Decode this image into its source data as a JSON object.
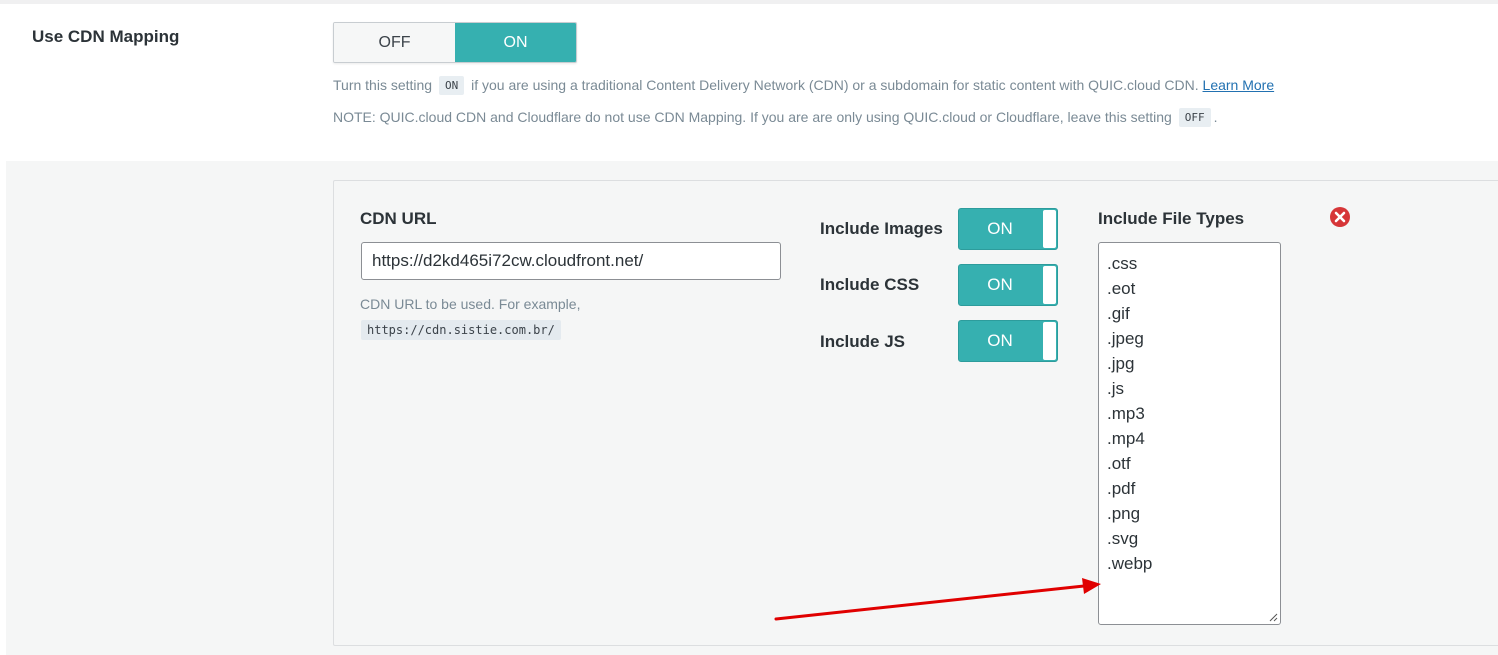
{
  "setting": {
    "label": "Use CDN Mapping",
    "toggle": {
      "off_label": "OFF",
      "on_label": "ON",
      "selected": "ON"
    },
    "description": {
      "line1_before": "Turn this setting",
      "line1_code": "ON",
      "line1_after": "if you are using a traditional Content Delivery Network (CDN) or a subdomain for static content with QUIC.cloud CDN.",
      "learn_more": "Learn More",
      "line2_before": "NOTE: QUIC.cloud CDN and Cloudflare do not use CDN Mapping. If you are are only using QUIC.cloud or Cloudflare, leave this setting",
      "line2_code": "OFF",
      "line2_after": "."
    }
  },
  "mapping": {
    "cdn_url_label": "CDN URL",
    "cdn_url_value": "https://d2kd465i72cw.cloudfront.net/",
    "help_text": "CDN URL to be used. For example,",
    "help_example": "https://cdn.sistie.com.br/",
    "include_images": {
      "label": "Include Images",
      "state": "ON"
    },
    "include_css": {
      "label": "Include CSS",
      "state": "ON"
    },
    "include_js": {
      "label": "Include JS",
      "state": "ON"
    },
    "file_types_label": "Include File Types",
    "file_types": [
      ".css",
      ".eot",
      ".gif",
      ".jpeg",
      ".jpg",
      ".js",
      ".mp3",
      ".mp4",
      ".otf",
      ".pdf",
      ".png",
      ".svg",
      ".webp"
    ]
  },
  "colors": {
    "accent": "#36b0b0",
    "remove_icon": "#d63638",
    "annotation_arrow": "#e00000"
  },
  "icons": {
    "remove": "close-circle-icon",
    "annotation": "arrow-icon"
  }
}
